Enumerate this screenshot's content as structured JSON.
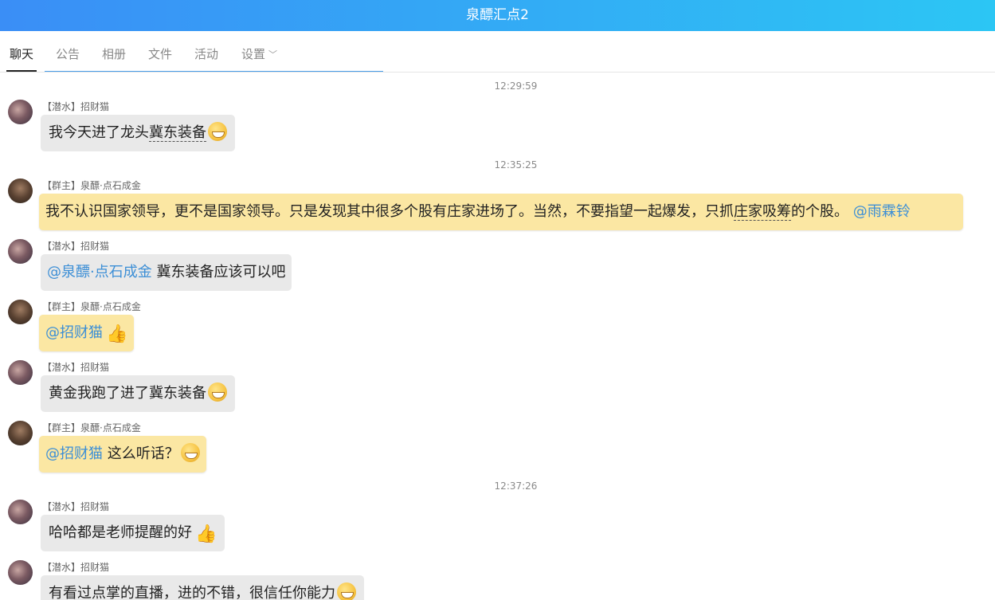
{
  "window": {
    "title": "泉醥汇点2"
  },
  "tabs": [
    {
      "label": "聊天"
    },
    {
      "label": "公告"
    },
    {
      "label": "相册"
    },
    {
      "label": "文件"
    },
    {
      "label": "活动"
    },
    {
      "label": "设置"
    }
  ],
  "timestamps": [
    "12:29:59",
    "12:35:25",
    "12:37:26"
  ],
  "senders": {
    "cat": "【潜水】招财猫",
    "owner": "【群主】泉醥·点石成金"
  },
  "messages": [
    {
      "before": "我今天进了龙头",
      "dashed": "冀东装备",
      "icon": "grin-emoji"
    },
    {
      "text1": "我不认识国家领导，更不是国家领导。只是发现其中很多个股有庄家进场了。当然，不要指望一起爆发，只抓",
      "dashed": "庄家吸筹",
      "text2": "的个股。",
      "mention": "@雨霖铃"
    },
    {
      "mention": "@泉醥·点石成金",
      "text": "冀东装备应该可以吧"
    },
    {
      "mention": "@招财猫",
      "icon": "thumbs-up-emoji"
    },
    {
      "text": "黄金我跑了进了冀东装备",
      "icon": "grin-emoji"
    },
    {
      "mention": "@招财猫",
      "text": "这么听话？",
      "icon": "grin-emoji"
    },
    {
      "text": "哈哈都是老师提醒的好",
      "icon": "thumbs-up-emoji"
    },
    {
      "text": "有看过点掌的直播，进的不错，很信任你能力",
      "icon": "grin-emoji"
    }
  ]
}
